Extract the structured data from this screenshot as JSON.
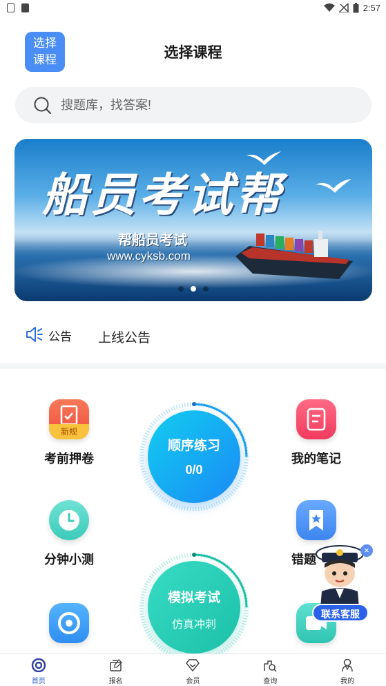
{
  "status_bar": {
    "time": "2:57"
  },
  "header": {
    "course_button": "选择\n课程",
    "course_line1": "选择",
    "course_line2": "课程",
    "title": "选择课程"
  },
  "search": {
    "placeholder": "搜题库，找答案!"
  },
  "banner": {
    "title": "船员考试帮",
    "subtitle": "帮船员考试",
    "url": "www.cyksb.com",
    "dot_count": 3,
    "active_dot": 1
  },
  "notice": {
    "label": "公告",
    "text": "上线公告"
  },
  "grid": {
    "exam_tips": {
      "label": "考前押卷",
      "badge": "新规",
      "color": "#f25a4a"
    },
    "my_notes": {
      "label": "我的笔记",
      "color": "#f5466a"
    },
    "quick_test": {
      "label": "分钟小测",
      "color": "#4fd6c8"
    },
    "wrong_questions": {
      "label": "错题",
      "color": "#4a90f0"
    },
    "bottom_left": {
      "color": "#3a9cf0"
    },
    "bottom_right": {
      "color": "#3ad0c0"
    }
  },
  "practice": {
    "title": "顺序练习",
    "count": "0/0"
  },
  "mock_exam": {
    "title": "模拟考试",
    "subtitle": "仿真冲刺"
  },
  "customer_service": {
    "label": "联系客服",
    "close": "×"
  },
  "tabs": [
    {
      "label": "首页",
      "icon": "home-icon",
      "active": true
    },
    {
      "label": "报名",
      "icon": "signup-icon",
      "active": false
    },
    {
      "label": "会员",
      "icon": "member-icon",
      "active": false
    },
    {
      "label": "查询",
      "icon": "query-icon",
      "active": false
    },
    {
      "label": "我的",
      "icon": "profile-icon",
      "active": false
    }
  ]
}
